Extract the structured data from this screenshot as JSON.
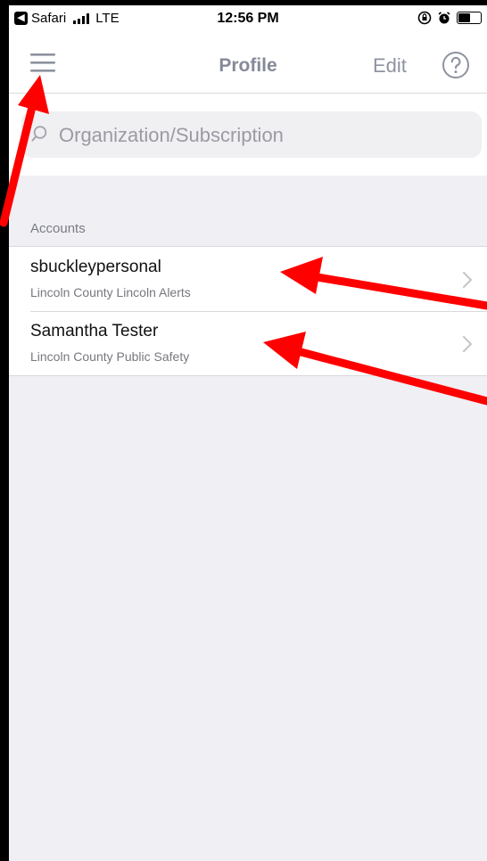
{
  "status_bar": {
    "back_app": "Safari",
    "carrier": "LTE",
    "time": "12:56 PM"
  },
  "nav": {
    "title": "Profile",
    "edit_label": "Edit"
  },
  "search": {
    "placeholder": "Organization/Subscription"
  },
  "accounts": {
    "header": "Accounts",
    "items": [
      {
        "name": "sbuckleypersonal",
        "subtitle": "Lincoln County Lincoln Alerts"
      },
      {
        "name": "Samantha Tester",
        "subtitle": "Lincoln County Public Safety"
      }
    ]
  },
  "colors": {
    "annotation_arrow": "#ff0000",
    "nav_tint": "#868a98",
    "grouped_bg": "#efeff4"
  },
  "icons": [
    "hamburger-menu-icon",
    "help-icon",
    "search-icon",
    "chevron-right-icon",
    "alarm-icon",
    "rotation-lock-icon",
    "battery-icon",
    "signal-icon"
  ]
}
